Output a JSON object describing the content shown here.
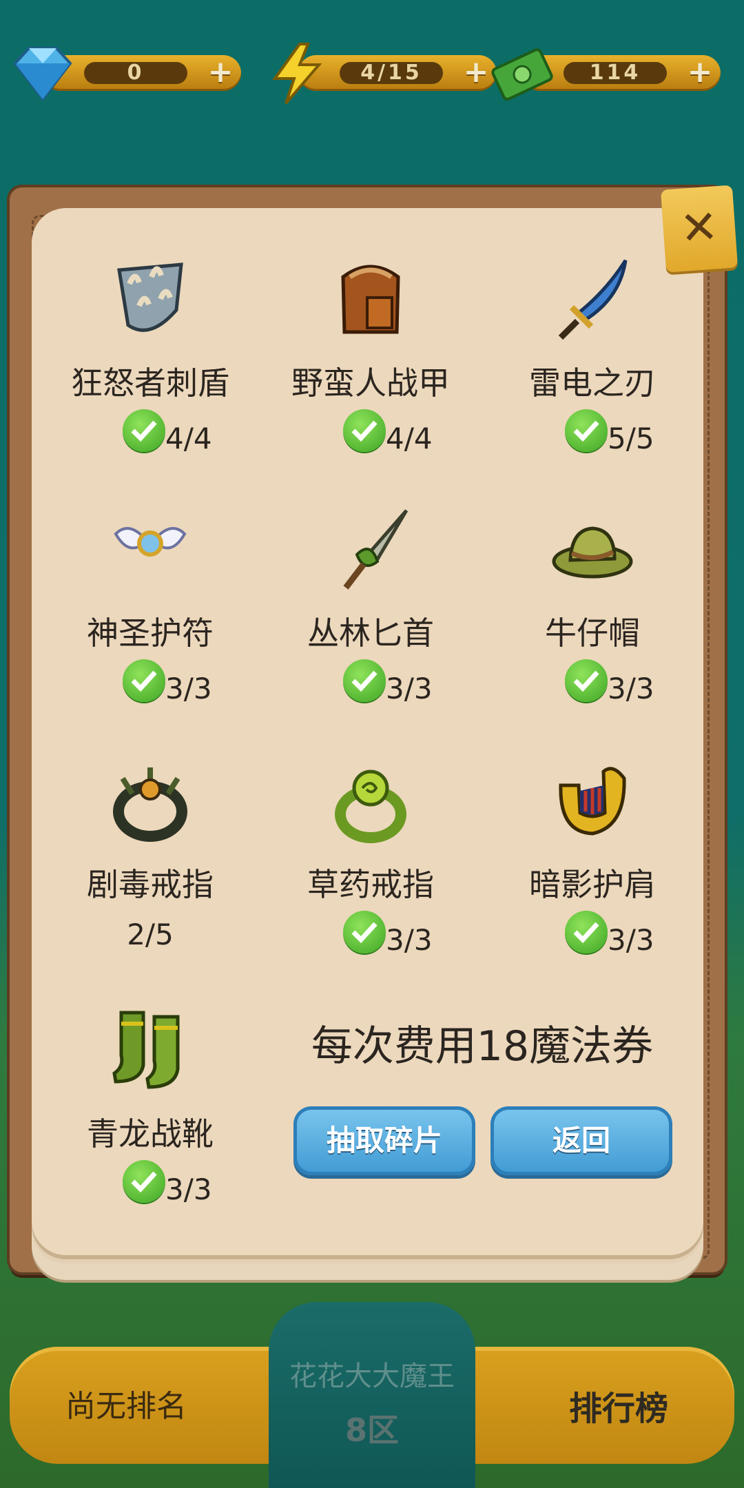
{
  "resources": {
    "gems": {
      "value": "0",
      "icon": "gem-icon"
    },
    "energy": {
      "value": "4/15",
      "icon": "lightning-icon"
    },
    "cash": {
      "value": "114",
      "icon": "cash-icon"
    },
    "plus": "+"
  },
  "background": {
    "rank_text": "尚无排名",
    "leaderboard_label": "排行榜",
    "player_name": "花花大大魔王",
    "zone": "8区"
  },
  "dialog": {
    "close_label": "✕",
    "cost_text": "每次费用18魔法券",
    "draw_button": "抽取碎片",
    "back_button": "返回",
    "items": [
      {
        "name": "狂怒者刺盾",
        "count": "4/4",
        "complete": true,
        "icon": "spiked-shield-icon"
      },
      {
        "name": "野蛮人战甲",
        "count": "4/4",
        "complete": true,
        "icon": "leather-armor-icon"
      },
      {
        "name": "雷电之刃",
        "count": "5/5",
        "complete": true,
        "icon": "blue-sword-icon"
      },
      {
        "name": "神圣护符",
        "count": "3/3",
        "complete": true,
        "icon": "winged-amulet-icon"
      },
      {
        "name": "丛林匕首",
        "count": "3/3",
        "complete": true,
        "icon": "leaf-dagger-icon"
      },
      {
        "name": "牛仔帽",
        "count": "3/3",
        "complete": true,
        "icon": "cowboy-hat-icon"
      },
      {
        "name": "剧毒戒指",
        "count": "2/5",
        "complete": false,
        "icon": "spiked-ring-icon"
      },
      {
        "name": "草药戒指",
        "count": "3/3",
        "complete": true,
        "icon": "herb-ring-icon"
      },
      {
        "name": "暗影护肩",
        "count": "3/3",
        "complete": true,
        "icon": "shoulder-guard-icon"
      },
      {
        "name": "青龙战靴",
        "count": "3/3",
        "complete": true,
        "icon": "green-boots-icon"
      }
    ]
  }
}
